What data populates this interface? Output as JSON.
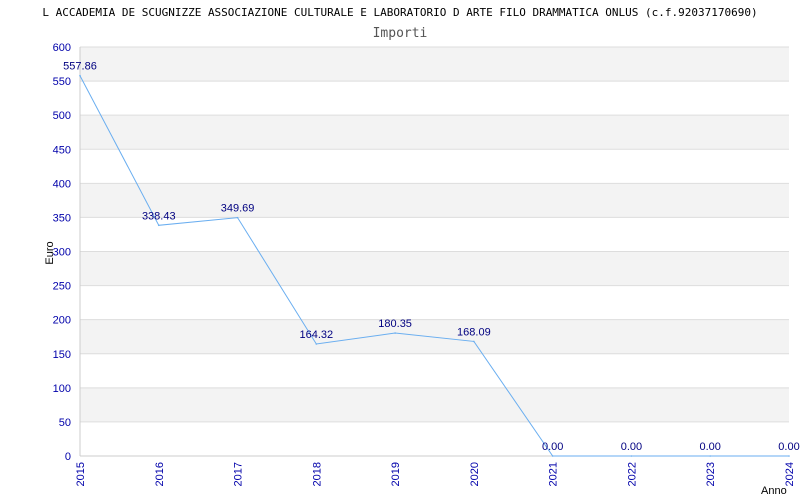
{
  "chart_data": {
    "type": "line",
    "title": "L ACCADEMIA DE SCUGNIZZE ASSOCIAZIONE CULTURALE E LABORATORIO D ARTE FILO DRAMMATICA ONLUS (c.f.92037170690)",
    "subtitle": "Importi",
    "xlabel": "Anno",
    "ylabel": "Euro",
    "ylim": [
      0,
      600
    ],
    "y_ticks": [
      0,
      50,
      100,
      150,
      200,
      250,
      300,
      350,
      400,
      450,
      500,
      550,
      600
    ],
    "categories": [
      "2015",
      "2016",
      "2017",
      "2018",
      "2019",
      "2020",
      "2021",
      "2022",
      "2023",
      "2024"
    ],
    "series": [
      {
        "values": [
          557.86,
          338.43,
          349.69,
          164.32,
          180.35,
          168.09,
          0.0,
          0.0,
          0.0,
          0.0
        ],
        "value_labels": [
          "557.86",
          "338.43",
          "349.69",
          "164.32",
          "180.35",
          "168.09",
          "0.00",
          "0.00",
          "0.00",
          "0.00"
        ],
        "color": "#6aaef0"
      }
    ],
    "grid": true,
    "band_colors": [
      "#f3f3f3",
      "#ffffff"
    ],
    "gridline_color": "#dddddd"
  }
}
